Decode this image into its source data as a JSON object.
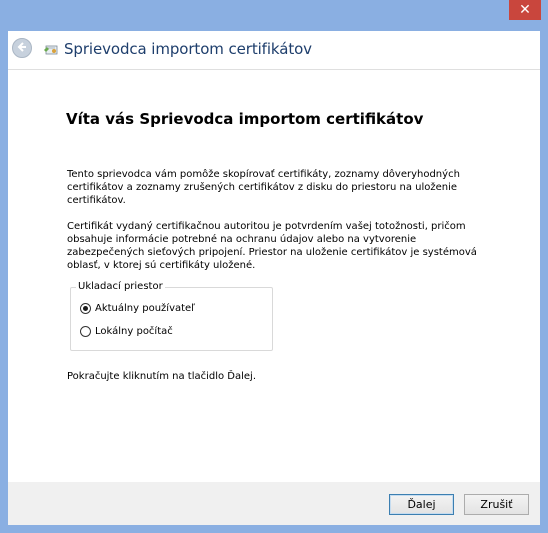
{
  "window": {
    "close_glyph": "✕",
    "title": "Sprievodca importom certifikátov"
  },
  "content": {
    "heading": "Víta vás Sprievodca importom certifikátov",
    "para1": "Tento sprievodca vám pomôže skopírovať certifikáty, zoznamy dôveryhodných certifikátov a zoznamy zrušených certifikátov z disku do priestoru na uloženie certifikátov.",
    "para2": "Certifikát vydaný certifikačnou autoritou je potvrdením vašej totožnosti, pričom obsahuje informácie potrebné na ochranu údajov alebo na vytvorenie zabezpečených sieťových pripojení. Priestor na uloženie certifikátov je systémová oblasť, v ktorej sú certifikáty uložené.",
    "store_group": {
      "label": "Ukladací priestor",
      "options": [
        {
          "label": "Aktuálny používateľ",
          "selected": true
        },
        {
          "label": "Lokálny počítač",
          "selected": false
        }
      ]
    },
    "continue_text": "Pokračujte kliknutím na tlačidlo Ďalej."
  },
  "footer": {
    "next_label": "Ďalej",
    "cancel_label": "Zrušiť"
  },
  "colors": {
    "accent_border": "#3c7fb1",
    "title_text": "#1e3e6c",
    "close_button": "#c9463d"
  }
}
